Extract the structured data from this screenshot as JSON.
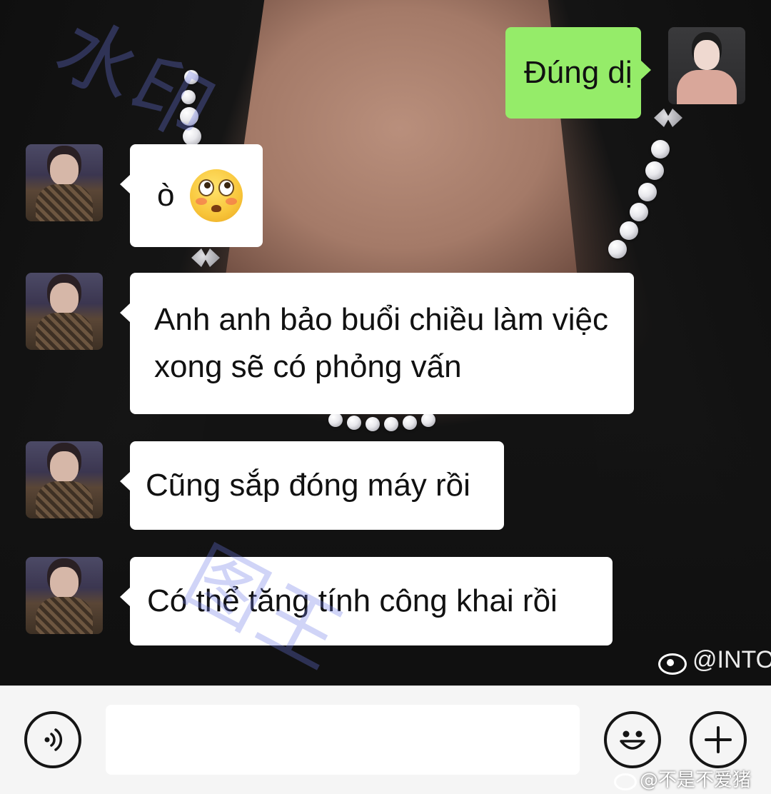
{
  "watermark_text": "水印",
  "watermark_text_2": "图王",
  "messages": [
    {
      "side": "out",
      "text": "Đúng dị"
    },
    {
      "side": "in",
      "text": "ò",
      "emoji": "flushed-face-emoji"
    },
    {
      "side": "in",
      "line1": "Anh anh bảo buổi chiều làm việc",
      "line2": "xong sẽ có phỏng vấn"
    },
    {
      "side": "in",
      "text": "Cũng sắp đóng máy rồi"
    },
    {
      "side": "in",
      "text": "Có thể tăng tính công khai rồi"
    }
  ],
  "image_watermark": "@INTO",
  "input_bar": {
    "voice_icon": "voice-icon",
    "emoji_icon": "smiley-icon",
    "plus_icon": "plus-icon",
    "input_placeholder": ""
  },
  "footer_watermark": "@不是不爱猪",
  "colors": {
    "bubble_out": "#95ec69",
    "bubble_in": "#ffffff",
    "input_bar_bg": "#f5f5f5"
  }
}
